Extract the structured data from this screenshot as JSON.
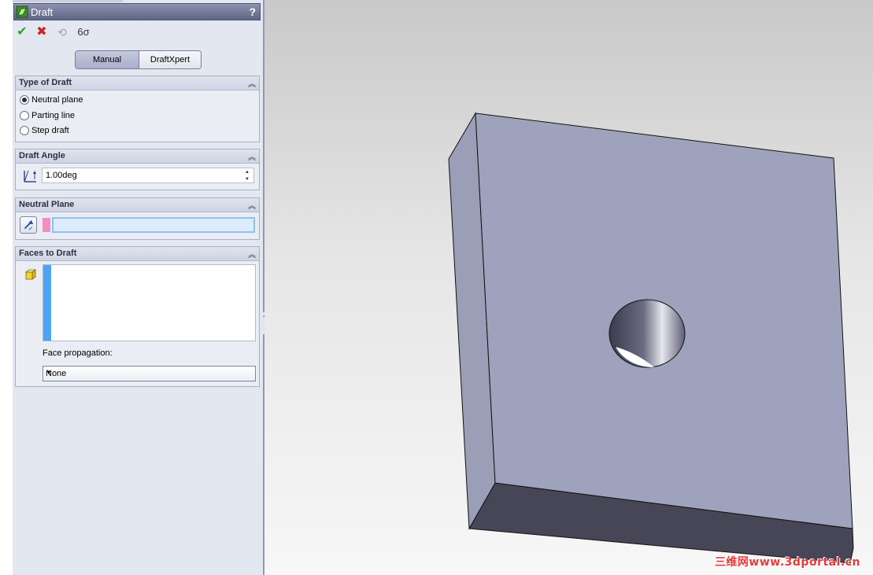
{
  "window": {
    "title": "Draft",
    "help_label": "?"
  },
  "actions": {
    "ok": "✔",
    "cancel": "✖",
    "undo": "⟲",
    "preview": "6σ"
  },
  "modes": {
    "manual": "Manual",
    "draftxpert": "DraftXpert",
    "selected": "Manual"
  },
  "type_of_draft": {
    "title": "Type of Draft",
    "collapse": "︽",
    "options": [
      {
        "label": "Neutral plane",
        "selected": true
      },
      {
        "label": "Parting line",
        "selected": false
      },
      {
        "label": "Step draft",
        "selected": false
      }
    ]
  },
  "draft_angle": {
    "title": "Draft Angle",
    "collapse": "︽",
    "value": "1.00deg",
    "spin_up": "▲",
    "spin_down": "▼"
  },
  "neutral_plane": {
    "title": "Neutral Plane",
    "collapse": "︽",
    "value": ""
  },
  "faces_to_draft": {
    "title": "Faces to Draft",
    "collapse": "︽",
    "face_propagation_label": "Face propagation:",
    "face_propagation_value": "None",
    "dropdown_arrow": "▼"
  },
  "panel_handle": "◂◂◂",
  "watermark": "三维网www.3dportal.cn",
  "colors": {
    "model_face": "#9ea2bc",
    "model_side": "#9a9eb7",
    "model_bottom": "#474657",
    "hole_shadow": "#3e3c4f",
    "accent": "#4da4f5",
    "selection_pink": "#ef8fc2"
  }
}
